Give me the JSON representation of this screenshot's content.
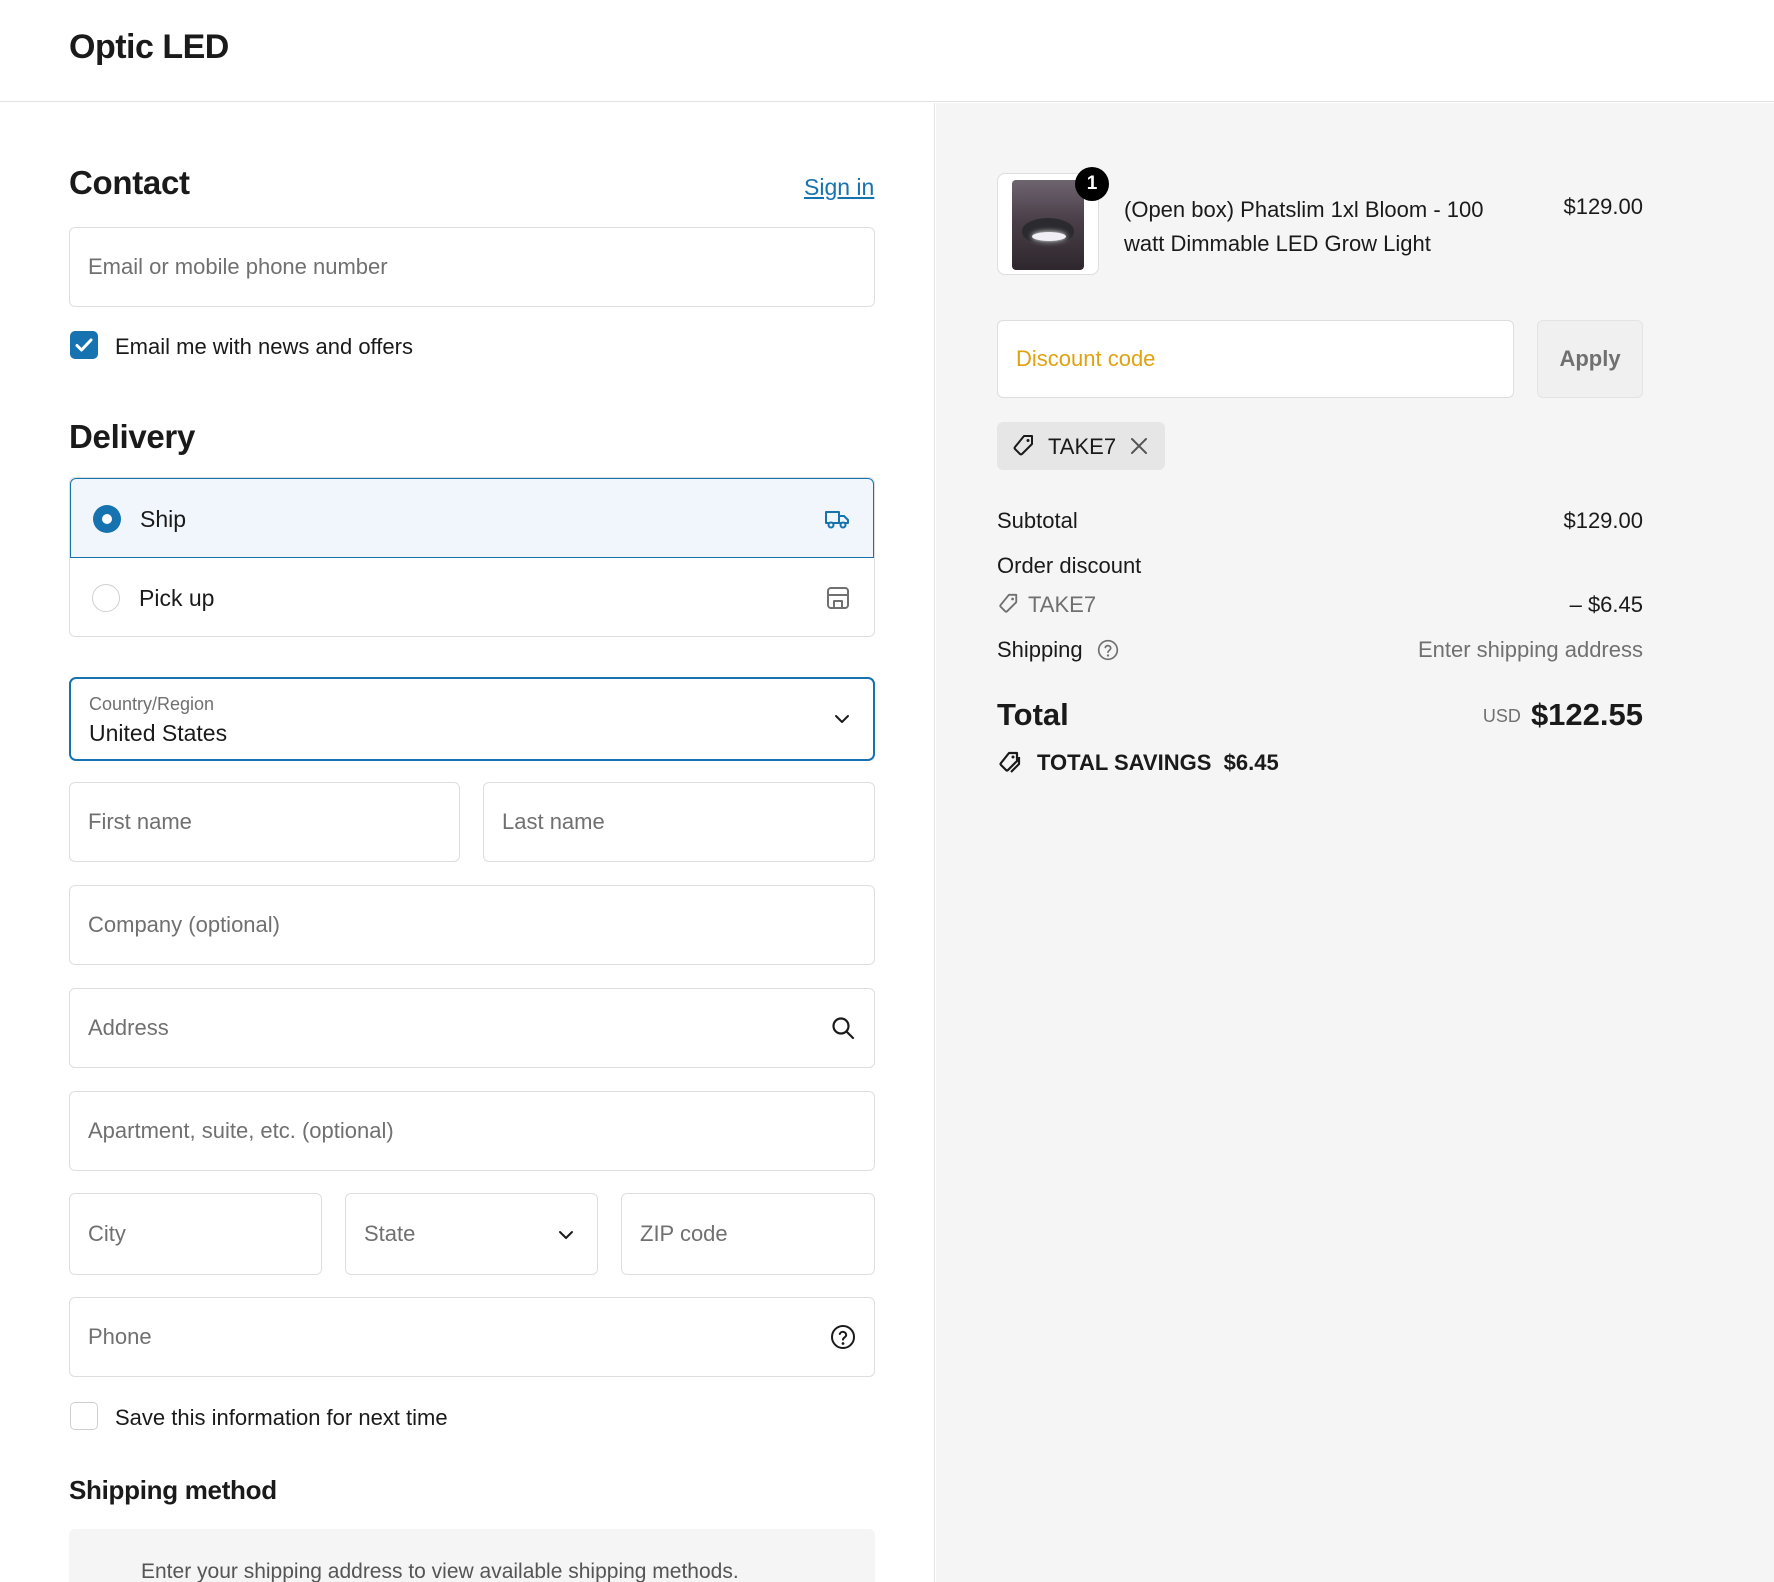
{
  "header": {
    "brand": "Optic LED"
  },
  "contact": {
    "title": "Contact",
    "sign_in": "Sign in",
    "email_placeholder": "Email or mobile phone number",
    "news_checkbox_label": "Email me with news and offers",
    "news_checked": true
  },
  "delivery": {
    "title": "Delivery",
    "options": [
      {
        "label": "Ship",
        "selected": true,
        "icon": "truck-icon"
      },
      {
        "label": "Pick up",
        "selected": false,
        "icon": "store-icon"
      }
    ],
    "country_label": "Country/Region",
    "country_value": "United States",
    "first_name_placeholder": "First name",
    "last_name_placeholder": "Last name",
    "company_placeholder": "Company (optional)",
    "address_placeholder": "Address",
    "apartment_placeholder": "Apartment, suite, etc. (optional)",
    "city_placeholder": "City",
    "state_placeholder": "State",
    "zip_placeholder": "ZIP code",
    "phone_placeholder": "Phone",
    "save_info_label": "Save this information for next time"
  },
  "shipping_method": {
    "title": "Shipping method",
    "message": "Enter your shipping address to view available shipping methods."
  },
  "summary": {
    "item": {
      "quantity": "1",
      "name": "(Open box) Phatslim 1xl Bloom - 100 watt Dimmable LED Grow Light",
      "price": "$129.00"
    },
    "discount_placeholder": "Discount code",
    "apply_label": "Apply",
    "applied_code": "TAKE7",
    "subtotal_label": "Subtotal",
    "subtotal_value": "$129.00",
    "order_discount_label": "Order discount",
    "discount_code": "TAKE7",
    "discount_value": "– $6.45",
    "shipping_label": "Shipping",
    "shipping_value": "Enter shipping address",
    "total_label": "Total",
    "total_currency": "USD",
    "total_value": "$122.55",
    "savings_label": "TOTAL SAVINGS",
    "savings_value": "$6.45"
  },
  "colors": {
    "accent": "#1773b0",
    "discount_text": "#e0a20f",
    "summary_bg": "#f5f5f5"
  }
}
